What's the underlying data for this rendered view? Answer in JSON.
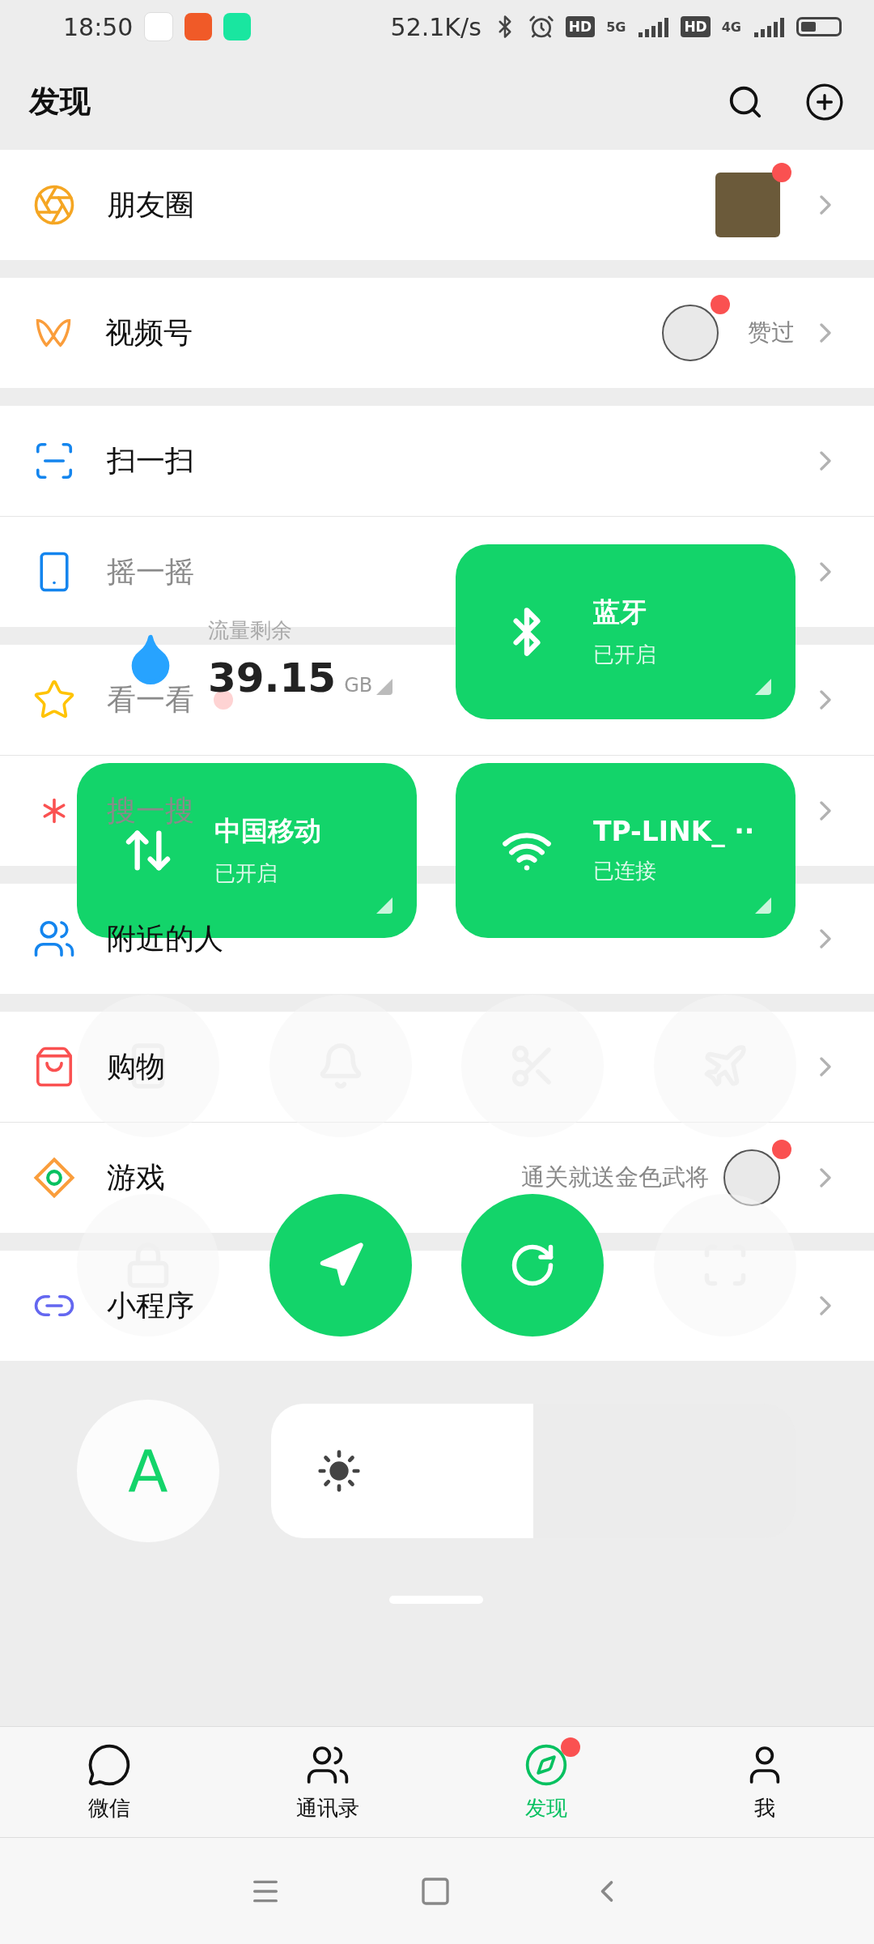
{
  "status_bar": {
    "time": "18:50",
    "speed": "52.1K/s",
    "hd_1": "HD",
    "network_1": "5G",
    "hd_2": "HD",
    "network_2": "4G"
  },
  "header": {
    "title": "发现"
  },
  "groups": [
    {
      "items": [
        {
          "label": "朋友圈",
          "faded": false,
          "dot": true,
          "photo": true
        }
      ]
    },
    {
      "items": [
        {
          "label": "视频号",
          "faded": false,
          "dot": true,
          "avatar": true,
          "note": "赞过"
        }
      ]
    },
    {
      "items": [
        {
          "label": "扫一扫",
          "faded": false,
          "dot": false
        },
        {
          "label": "摇一摇",
          "faded": true,
          "dot": false
        }
      ]
    },
    {
      "items": [
        {
          "label": "看一看",
          "faded": true,
          "dot": true
        },
        {
          "label": "搜一搜",
          "faded": true,
          "dot": false
        }
      ]
    },
    {
      "items": [
        {
          "label": "附近的人",
          "faded": false,
          "dot": false
        }
      ]
    },
    {
      "items": [
        {
          "label": "购物",
          "faded": false,
          "dot": false
        },
        {
          "label": "游戏",
          "faded": false,
          "dot": true,
          "avatar": true,
          "note": "通关就送金色武将"
        }
      ]
    },
    {
      "items": [
        {
          "label": "小程序",
          "faded": false,
          "dot": false
        }
      ]
    }
  ],
  "overlay": {
    "data_tile": {
      "label": "流量剩余",
      "value": "39.15",
      "unit": "GB"
    },
    "tiles": [
      {
        "title": "蓝牙",
        "status": "已开启",
        "on": true
      },
      {
        "title": "中国移动",
        "status": "已开启",
        "on": true
      },
      {
        "title": "TP-LINK_ ··",
        "status": "已连接",
        "on": true
      }
    ],
    "toggles": [
      {
        "on": false
      },
      {
        "on": false
      },
      {
        "on": false
      },
      {
        "on": false
      },
      {
        "on": false
      },
      {
        "on": true
      },
      {
        "on": true
      },
      {
        "on": false
      }
    ],
    "auto_brightness": {
      "label": "A",
      "on": true
    },
    "brightness": {
      "level": 0.5
    }
  },
  "tabs": [
    {
      "label": "微信",
      "selected": false,
      "dot": false
    },
    {
      "label": "通讯录",
      "selected": false,
      "dot": false
    },
    {
      "label": "发现",
      "selected": true,
      "dot": true
    },
    {
      "label": "我",
      "selected": false,
      "dot": false
    }
  ]
}
